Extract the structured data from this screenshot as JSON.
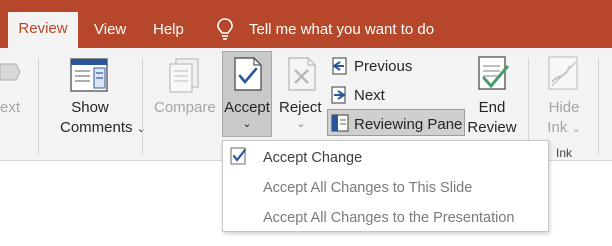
{
  "tabs": {
    "review": "Review",
    "view": "View",
    "help": "Help",
    "tell_me": "Tell me what you want to do"
  },
  "ribbon": {
    "text_partial": "ext",
    "show_comments_line1": "Show",
    "show_comments_line2": "Comments",
    "compare": "Compare",
    "accept": "Accept",
    "reject": "Reject",
    "previous": "Previous",
    "next": "Next",
    "reviewing_pane": "Reviewing Pane",
    "end_review_line1": "End",
    "end_review_line2": "Review",
    "hide_ink_line1": "Hide",
    "hide_ink_line2": "Ink",
    "ink_group": "Ink",
    "dropdown_arrow": "⌄"
  },
  "accept_menu": {
    "items": [
      {
        "label": "Accept Change",
        "checked": true,
        "enabled": true
      },
      {
        "label": "Accept All Changes to This Slide",
        "checked": false,
        "enabled": false
      },
      {
        "label": "Accept All Changes to the Presentation",
        "checked": false,
        "enabled": false
      }
    ]
  },
  "colors": {
    "title_bar": "#b7472a",
    "ribbon_bg": "#f3f3f3",
    "icon_blue": "#2b579a",
    "icon_green": "#4a9a6a"
  },
  "icons": {
    "tell_me": "lightbulb-icon",
    "accept": "accept-doc-icon",
    "reject": "reject-doc-icon",
    "previous": "previous-comment-icon",
    "next": "next-comment-icon",
    "reviewing_pane": "reviewing-pane-icon",
    "end_review": "end-review-icon",
    "hide_ink": "hide-ink-icon",
    "show_comments": "show-comments-icon",
    "compare": "compare-icon"
  }
}
